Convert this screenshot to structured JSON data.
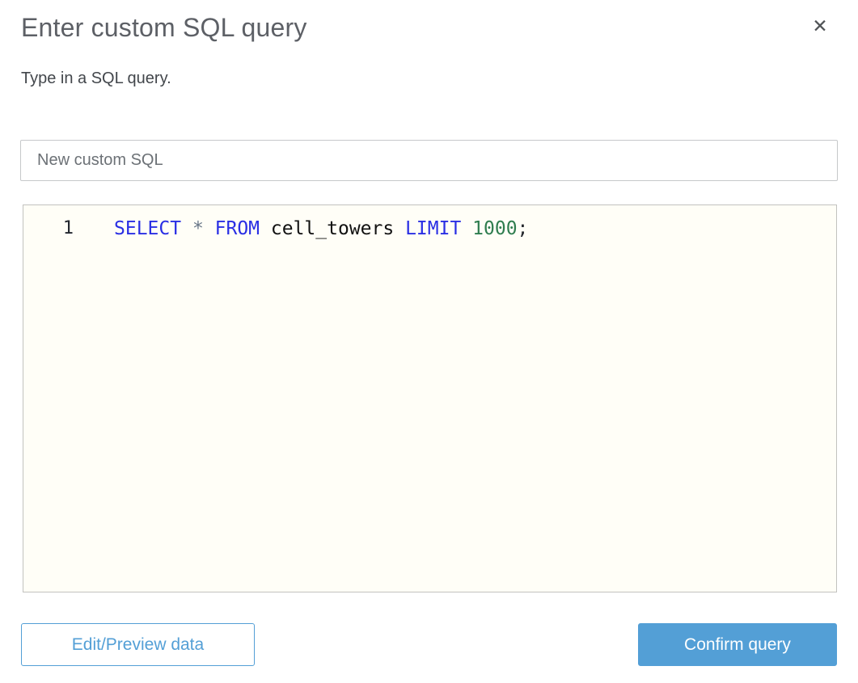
{
  "dialog": {
    "title": "Enter custom SQL query",
    "subtitle": "Type in a SQL query.",
    "close_icon_glyph": "✕"
  },
  "query_name_input": {
    "value": "New custom SQL"
  },
  "editor": {
    "line1": {
      "number": "1",
      "tokens": [
        {
          "text": "SELECT ",
          "type": "keyword"
        },
        {
          "text": "* ",
          "type": "operator"
        },
        {
          "text": "FROM ",
          "type": "keyword"
        },
        {
          "text": "cell_towers ",
          "type": "identifier"
        },
        {
          "text": "LIMIT ",
          "type": "keyword"
        },
        {
          "text": "1000",
          "type": "number"
        },
        {
          "text": ";",
          "type": "punctuation"
        }
      ],
      "full_text": "SELECT * FROM cell_towers LIMIT 1000;"
    }
  },
  "buttons": {
    "edit_preview": {
      "label": "Edit/Preview data"
    },
    "confirm": {
      "label": "Confirm query"
    }
  },
  "colors": {
    "accent_blue": "#539fd6",
    "title_gray": "#5d6066",
    "editor_background": "#fffef7",
    "keyword": "#2a2fe4",
    "operator": "#687687",
    "identifier": "#111111",
    "number": "#2f7d4f"
  }
}
